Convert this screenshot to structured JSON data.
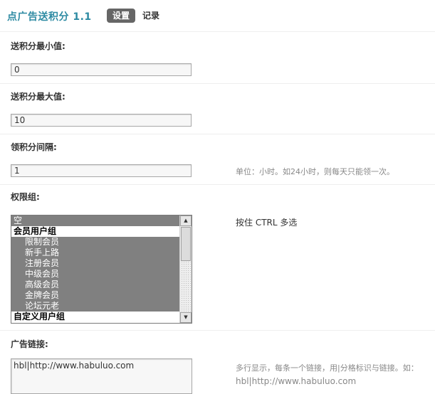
{
  "header": {
    "title": "点广告送积分 1.1",
    "tabs": [
      {
        "label": "设置",
        "active": true
      },
      {
        "label": "记录",
        "active": false
      }
    ]
  },
  "fields": {
    "min_points": {
      "label": "送积分最小值:",
      "value": "0"
    },
    "max_points": {
      "label": "送积分最大值:",
      "value": "10"
    },
    "interval": {
      "label": "领积分间隔:",
      "value": "1",
      "hint": "单位：小时。如24小时，则每天只能领一次。"
    },
    "groups": {
      "label": "权限组:",
      "hint": "按住 CTRL 多选",
      "options": [
        {
          "text": "空",
          "type": "option",
          "selected": true
        },
        {
          "text": "会员用户组",
          "type": "group"
        },
        {
          "text": "限制会员",
          "type": "child",
          "selected": true
        },
        {
          "text": "新手上路",
          "type": "child",
          "selected": true
        },
        {
          "text": "注册会员",
          "type": "child",
          "selected": true
        },
        {
          "text": "中级会员",
          "type": "child",
          "selected": true
        },
        {
          "text": "高级会员",
          "type": "child",
          "selected": true
        },
        {
          "text": "金牌会员",
          "type": "child",
          "selected": true
        },
        {
          "text": "论坛元老",
          "type": "child",
          "selected": true
        },
        {
          "text": "自定义用户组",
          "type": "group"
        }
      ]
    },
    "ad_link": {
      "label": "广告链接:",
      "value": "hbl|http://www.habuluo.com",
      "hint_line1": "多行显示，每条一个链接，用|分格标识与链接。如：",
      "hint_line2": "hbl|http://www.habuluo.com"
    }
  },
  "colors": {
    "title": "#2e8ba3",
    "active_tab_bg": "#666666",
    "selected_option_bg": "#808080"
  }
}
